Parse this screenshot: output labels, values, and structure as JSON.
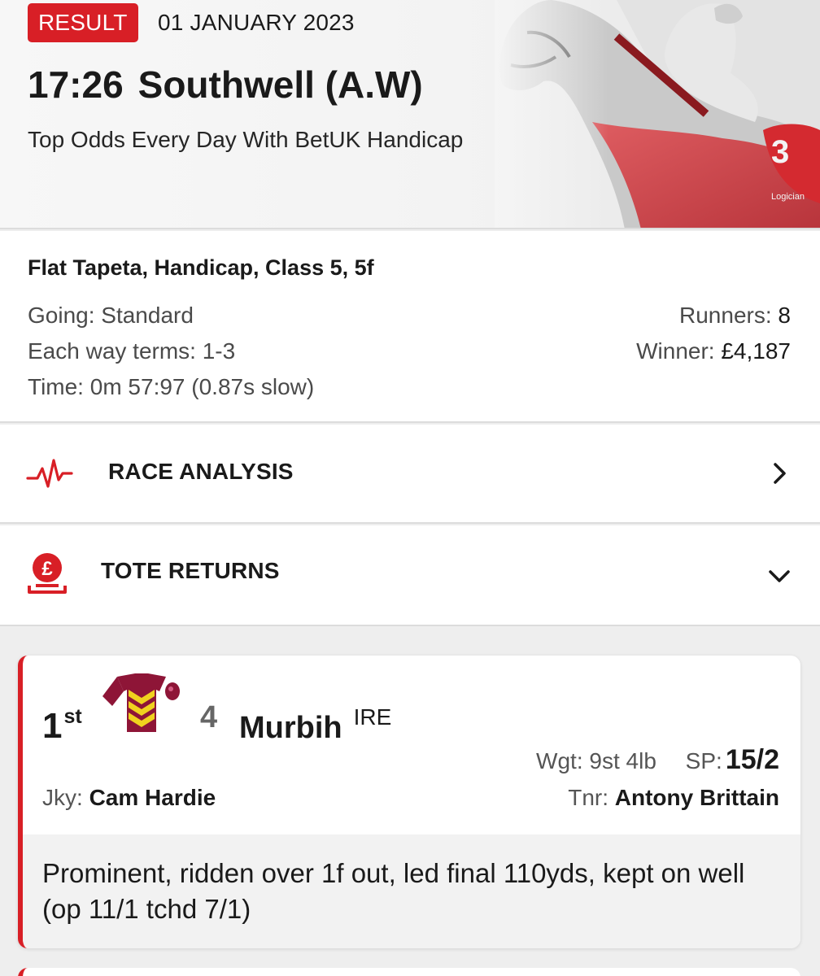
{
  "header": {
    "badge": "RESULT",
    "date": "01 JANUARY 2023",
    "time": "17:26",
    "course": "Southwell (A.W)",
    "race_name": "Top Odds Every Day With BetUK Handicap"
  },
  "info": {
    "type": "Flat Tapeta, Handicap, Class 5, 5f",
    "going_label": "Going:",
    "going": "Standard",
    "ew_label": "Each way terms:",
    "ew": "1-3",
    "time_label": "Time:",
    "time": "0m 57:97 (0.87s slow)",
    "runners_label": "Runners:",
    "runners": "8",
    "winner_label": "Winner:",
    "winner": "£4,187"
  },
  "rows": {
    "analysis_label": "RACE ANALYSIS",
    "tote_label": "TOTE RETURNS"
  },
  "runner": {
    "position": "1",
    "position_suffix": "st",
    "cloth": "4",
    "horse": "Murbih",
    "suffix": "IRE",
    "wgt_label": "Wgt:",
    "wgt": "9st 4lb",
    "sp_label": "SP:",
    "sp": "15/2",
    "jky_label": "Jky:",
    "jockey": "Cam Hardie",
    "tnr_label": "Tnr:",
    "trainer": "Antony Brittain",
    "comment": "Prominent, ridden over 1f out, led final 110yds, kept on well (op 11/1 tchd 7/1)"
  },
  "colors": {
    "accent": "#d81f26",
    "silks_body": "#8e1537",
    "silks_chevron": "#f0d21e"
  },
  "icons": {
    "analysis": "pulse-icon",
    "tote": "pound-coin-icon",
    "analysis_chevron": "chevron-right-icon",
    "tote_chevron": "chevron-down-icon"
  }
}
